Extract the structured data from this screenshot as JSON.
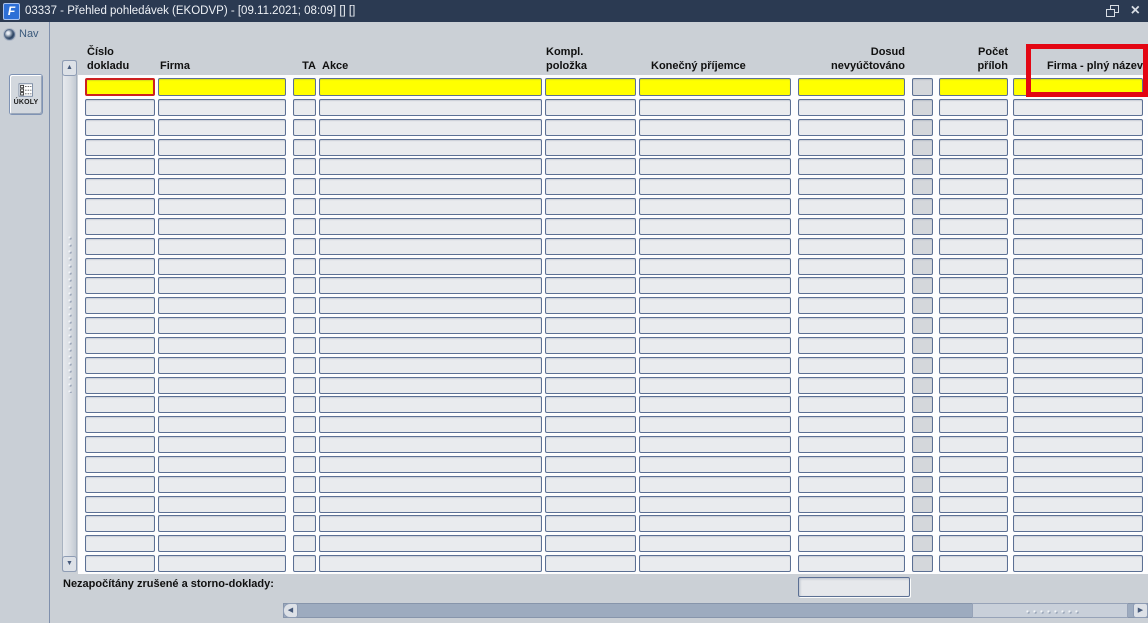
{
  "window": {
    "title": "03337 - Přehled pohledávek (EKODVP) - [09.11.2021; 08:09] [] []",
    "app_icon_glyph": "F",
    "close_icon_glyph": "×"
  },
  "sidebar": {
    "nav_label": "Nav",
    "tasks_button_label": "ÚKOLY"
  },
  "table": {
    "columns": [
      {
        "id": "cislo-dokladu",
        "line1": "Číslo",
        "line2": "dokladu"
      },
      {
        "id": "firma",
        "line1": "",
        "line2": "Firma"
      },
      {
        "id": "ta",
        "line1": "",
        "line2": "TA"
      },
      {
        "id": "akce",
        "line1": "",
        "line2": "Akce"
      },
      {
        "id": "kompl-polozka",
        "line1": "Kompl.",
        "line2": "položka"
      },
      {
        "id": "konecny-prijemce",
        "line1": "",
        "line2": "Konečný příjemce"
      },
      {
        "id": "dosud-nevyuctovano",
        "line1": "Dosud",
        "line2": "nevyúčtováno"
      },
      {
        "id": "attachment-button",
        "line1": "",
        "line2": ""
      },
      {
        "id": "pocet-priloh",
        "line1": "Počet",
        "line2": "příloh"
      },
      {
        "id": "firma-plny-nazev",
        "line1": "",
        "line2": "Firma - plný název"
      }
    ],
    "filter_row_values": [
      "",
      "",
      "",
      "",
      "",
      "",
      "",
      "",
      "",
      ""
    ],
    "empty_row_count": 24
  },
  "footer": {
    "note_label": "Nezapočítány zrušené a storno-doklady:",
    "note_value": ""
  },
  "scrollbars": {
    "up_glyph": "▲",
    "down_glyph": "▼",
    "left_glyph": "◀",
    "right_glyph": "▶"
  },
  "colors": {
    "titlebar": "#2b3a52",
    "filter_highlight": "#ffff00",
    "focus_border": "#cc2020",
    "annotation_box": "#e30613",
    "cell_border": "#5c7094",
    "window_bg": "#cbd0d6"
  }
}
